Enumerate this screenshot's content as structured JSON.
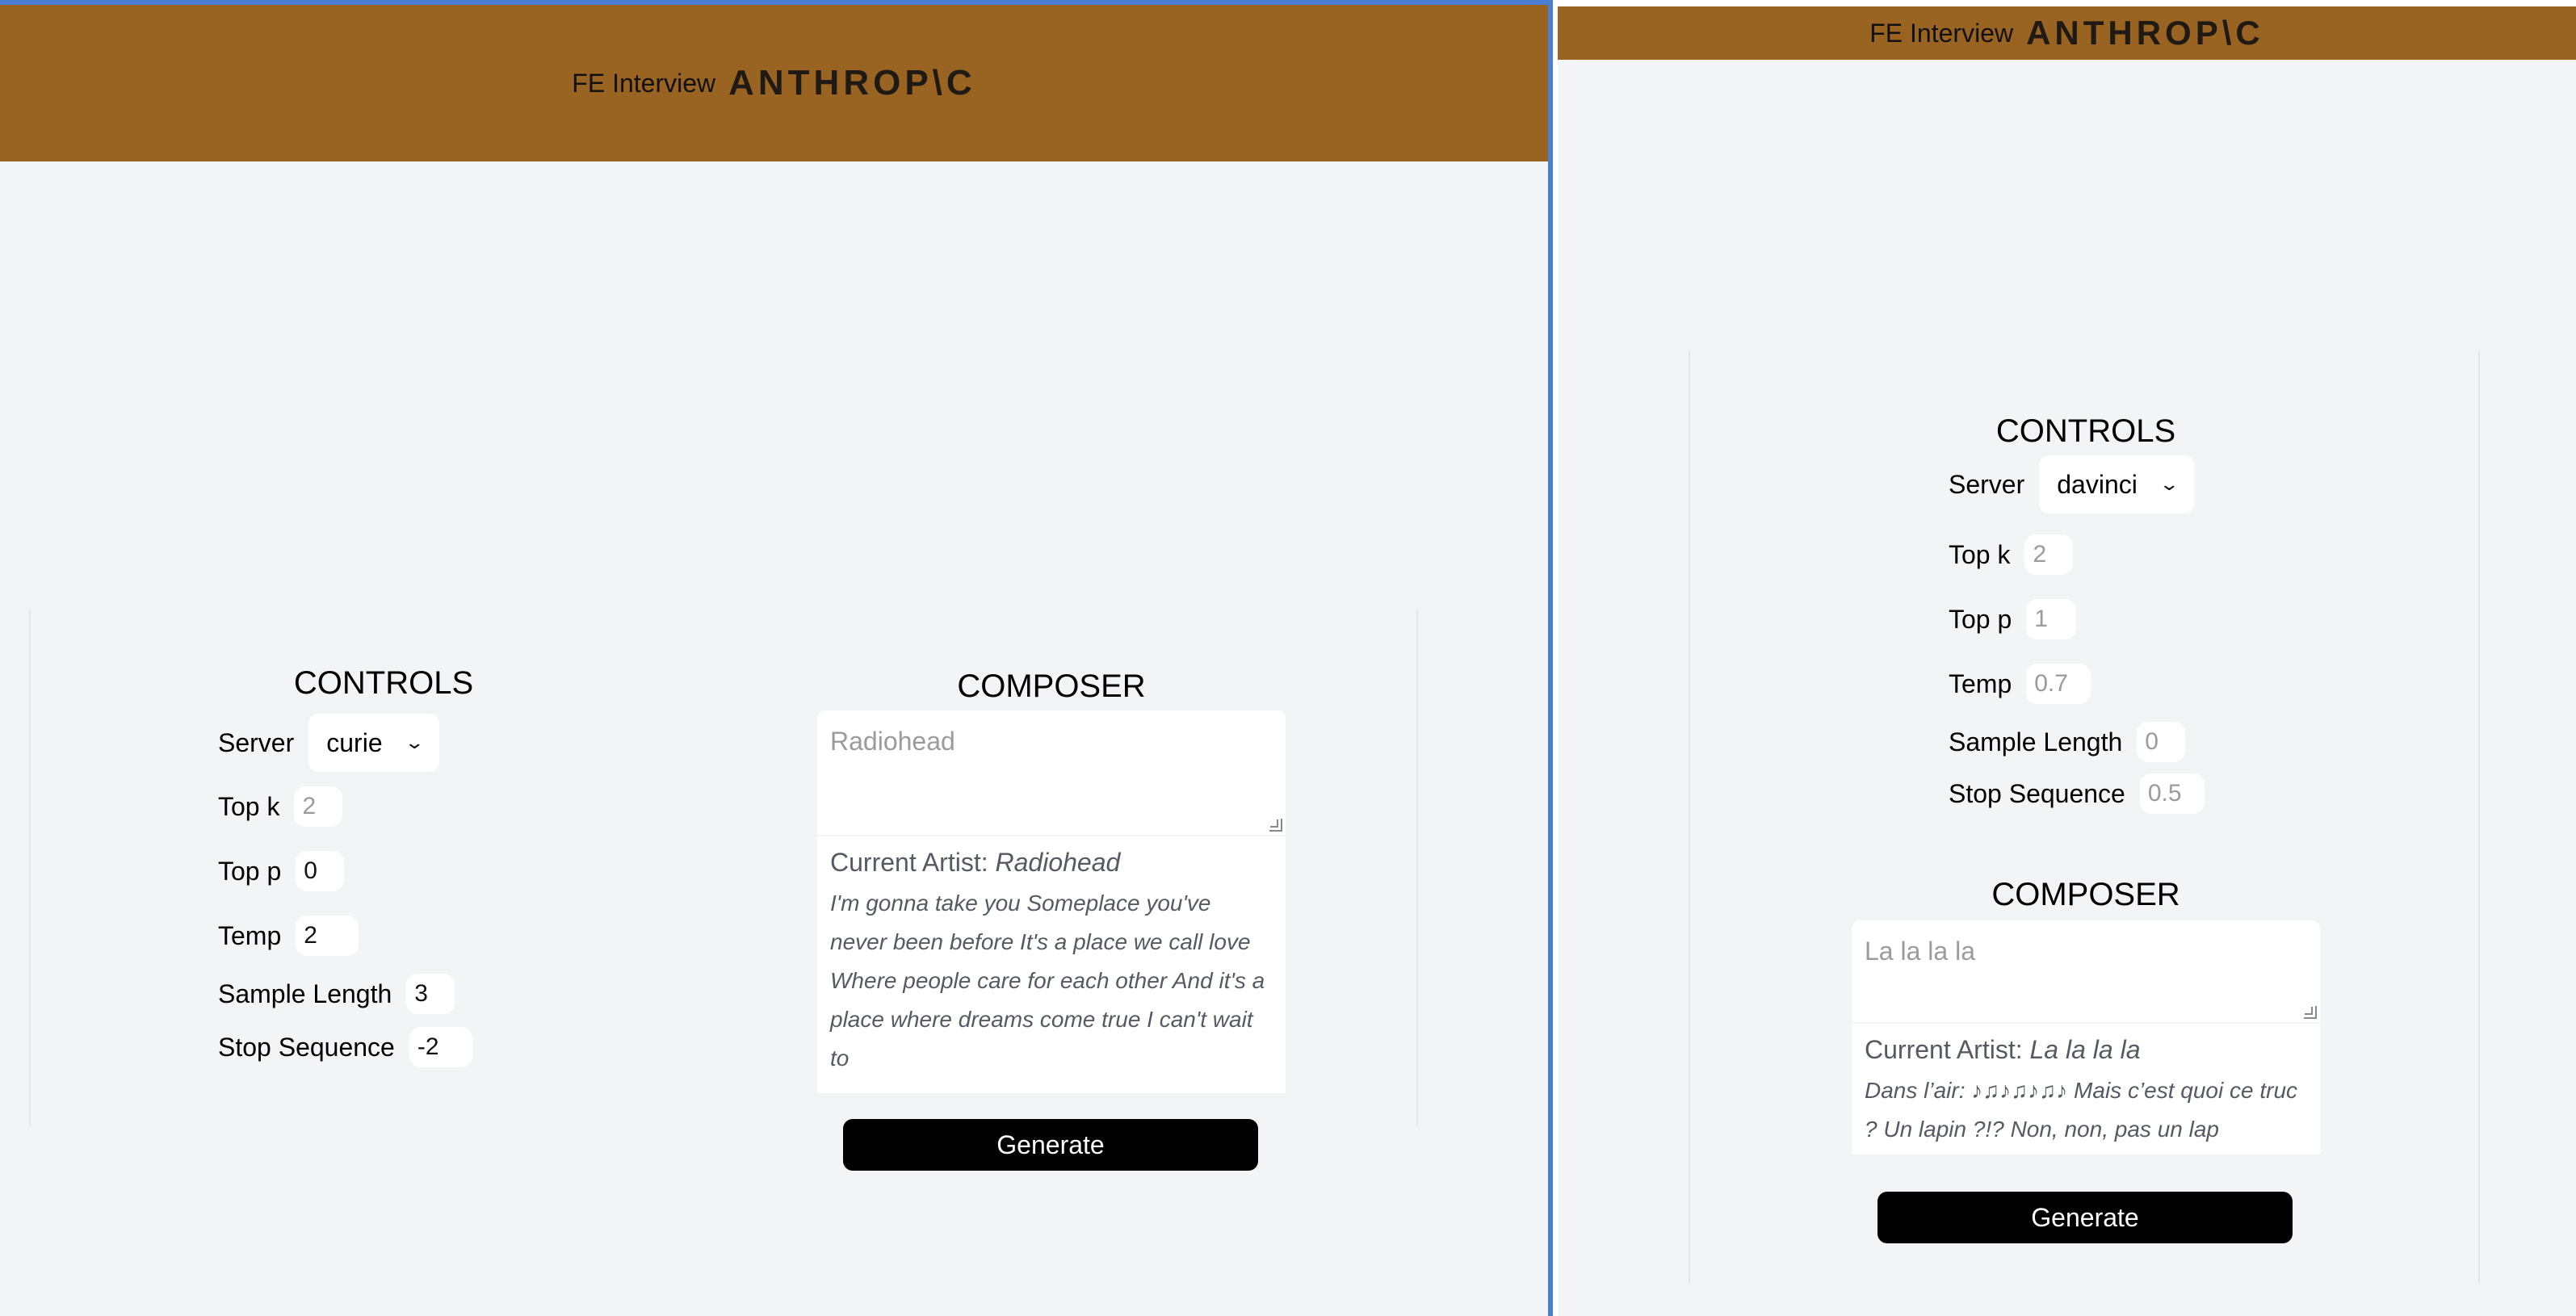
{
  "left": {
    "header": {
      "fe_label": "FE Interview",
      "logo_text": "ANTHROP\\C"
    },
    "controls": {
      "title": "CONTROLS",
      "server_label": "Server",
      "server_value": "curie",
      "top_k_label": "Top k",
      "top_k_value": "2",
      "top_p_label": "Top p",
      "top_p_value": "0",
      "temp_label": "Temp",
      "temp_value": "2",
      "sample_length_label": "Sample Length",
      "sample_length_value": "3",
      "stop_sequence_label": "Stop Sequence",
      "stop_sequence_value": "-2"
    },
    "composer": {
      "title": "COMPOSER",
      "input_placeholder": "Radiohead",
      "current_artist_label": "Current Artist:",
      "current_artist_name": "Radiohead",
      "lyrics": "I'm gonna take you Someplace you've never been before It's a place we call love Where people care for each other And it's a place where dreams come true I can't wait to",
      "generate_label": "Generate"
    }
  },
  "right": {
    "header": {
      "fe_label": "FE Interview",
      "logo_text": "ANTHROP\\C"
    },
    "controls": {
      "title": "CONTROLS",
      "server_label": "Server",
      "server_value": "davinci",
      "top_k_label": "Top k",
      "top_k_value": "2",
      "top_p_label": "Top p",
      "top_p_value": "1",
      "temp_label": "Temp",
      "temp_value": "0.7",
      "sample_length_label": "Sample Length",
      "sample_length_value": "0",
      "stop_sequence_label": "Stop Sequence",
      "stop_sequence_value": "0.5"
    },
    "composer": {
      "title": "COMPOSER",
      "input_placeholder": "La la la la",
      "current_artist_label": "Current Artist:",
      "current_artist_name": "La la la la",
      "lyrics": "Dans l’air: ♪♫♪♫♪♫♪ Mais c’est quoi ce truc ? Un lapin ?!? Non, non, pas un lap",
      "generate_label": "Generate"
    }
  }
}
